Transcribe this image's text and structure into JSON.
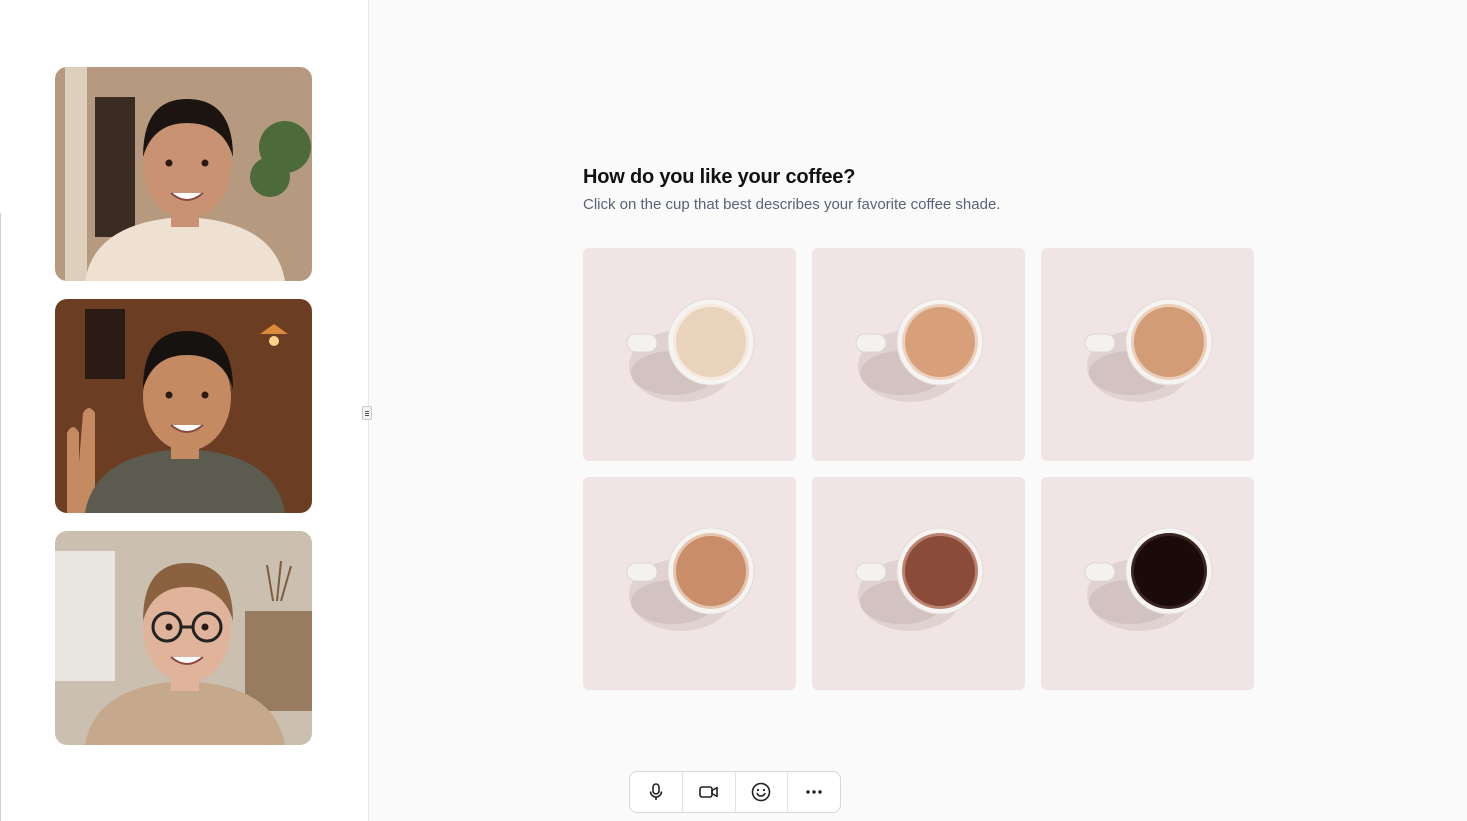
{
  "question": {
    "title": "How do you like your coffee?",
    "subtitle": "Click on the cup that best describes your favorite coffee shade."
  },
  "options": [
    {
      "coffee_color": "#ead3bd",
      "rim_color": "#f6e9de"
    },
    {
      "coffee_color": "#d7a07b",
      "rim_color": "#ecd2be"
    },
    {
      "coffee_color": "#d29c76",
      "rim_color": "#ebcfb9"
    },
    {
      "coffee_color": "#c98d69",
      "rim_color": "#e6c5ae"
    },
    {
      "coffee_color": "#8a4c38",
      "rim_color": "#b98370"
    },
    {
      "coffee_color": "#1a0a09",
      "rim_color": "#3a2420"
    }
  ],
  "participants": [
    {
      "skin": "#c99272",
      "hair": "#1c1410",
      "shirt": "#efe1d2",
      "bg": "#b59a80",
      "accent": "#4d6a3a"
    },
    {
      "skin": "#c48a62",
      "hair": "#161210",
      "shirt": "#5b5b50",
      "bg": "#6b3e24",
      "accent": "#d98a3a"
    },
    {
      "skin": "#e0b49a",
      "hair": "#8a6240",
      "shirt": "#c6a98c",
      "bg": "#cbbfb0",
      "accent": "#7a5c40"
    }
  ],
  "toolbar": {
    "icons": [
      "microphone-icon",
      "camera-icon",
      "emoji-icon",
      "more-icon"
    ]
  },
  "colors": {
    "card_background": "#f0e4e4",
    "subtitle": "#5a6373"
  }
}
